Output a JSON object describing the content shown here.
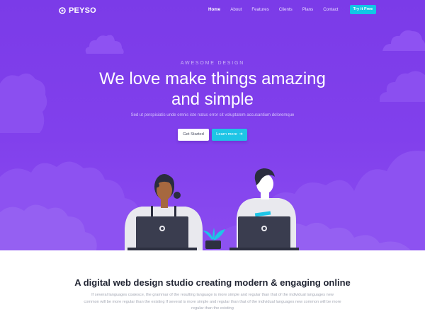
{
  "brand": {
    "name": "PEYSO",
    "logo_icon": "peyso-logo-icon"
  },
  "nav": {
    "items": [
      {
        "label": "Home",
        "active": true
      },
      {
        "label": "About",
        "active": false
      },
      {
        "label": "Features",
        "active": false
      },
      {
        "label": "Clients",
        "active": false
      },
      {
        "label": "Plans",
        "active": false
      },
      {
        "label": "Contact",
        "active": false
      }
    ],
    "cta_label": "Try it Free"
  },
  "hero": {
    "eyebrow": "AWESOME DESIGN",
    "headline_line1": "We love make things amazing",
    "headline_line2": "and simple",
    "subtitle": "Sed ut perspiciatis unde omnis iste natus error sit voluptatem accusantium doloremque",
    "primary_button": "Get Started",
    "secondary_button": "Learn more",
    "secondary_button_icon": "arrow-right-icon"
  },
  "section": {
    "title": "A digital web design studio creating modern & engaging online",
    "text": "If several languages coalesce, the grammar of the resulting language is more simple and regular than that of the individual languages new common will be more regular than the existing If several is more simple and regular than that of the individual languages new common will be more regular than the existing"
  },
  "colors": {
    "hero_purple": "#8140ec",
    "accent_cyan": "#1ec5e6",
    "text_dark": "#222634",
    "text_muted": "#a4a8b4"
  }
}
